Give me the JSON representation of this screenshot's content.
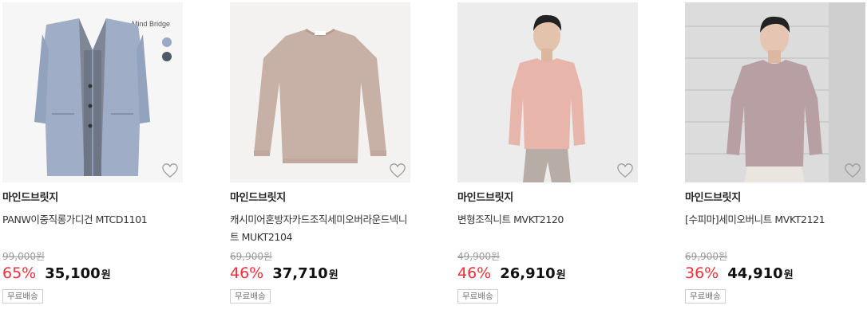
{
  "products": [
    {
      "image_label": "Mind Bridge",
      "brand": "마인드브릿지",
      "name": "PANW이중직롱가디건 MTCD1101",
      "original_price": "99,000원",
      "discount": "65%",
      "sale_price": "35,100",
      "currency": "원",
      "badge": "무료배송",
      "swatch_colors": [
        "#9aa9c4",
        "#4f5965"
      ],
      "icon": "heart-outline-icon"
    },
    {
      "brand": "마인드브릿지",
      "name": "캐시미어혼방자카드조직세미오버라운드넥니트 MUKT2104",
      "original_price": "69,900원",
      "discount": "46%",
      "sale_price": "37,710",
      "currency": "원",
      "badge": "무료배송",
      "icon": "heart-outline-icon"
    },
    {
      "brand": "마인드브릿지",
      "name": "변형조직니트 MVKT2120",
      "original_price": "49,900원",
      "discount": "46%",
      "sale_price": "26,910",
      "currency": "원",
      "badge": "무료배송",
      "icon": "heart-outline-icon"
    },
    {
      "brand": "마인드브릿지",
      "name": "[수피마]세미오버니트 MVKT2121",
      "original_price": "69,900원",
      "discount": "36%",
      "sale_price": "44,910",
      "currency": "원",
      "badge": "무료배송",
      "icon": "heart-outline-icon"
    }
  ],
  "colors": {
    "discount": "#f0303a",
    "sale_price": "#111111",
    "original_price": "#999999",
    "badge_border": "#cfcfcf"
  }
}
